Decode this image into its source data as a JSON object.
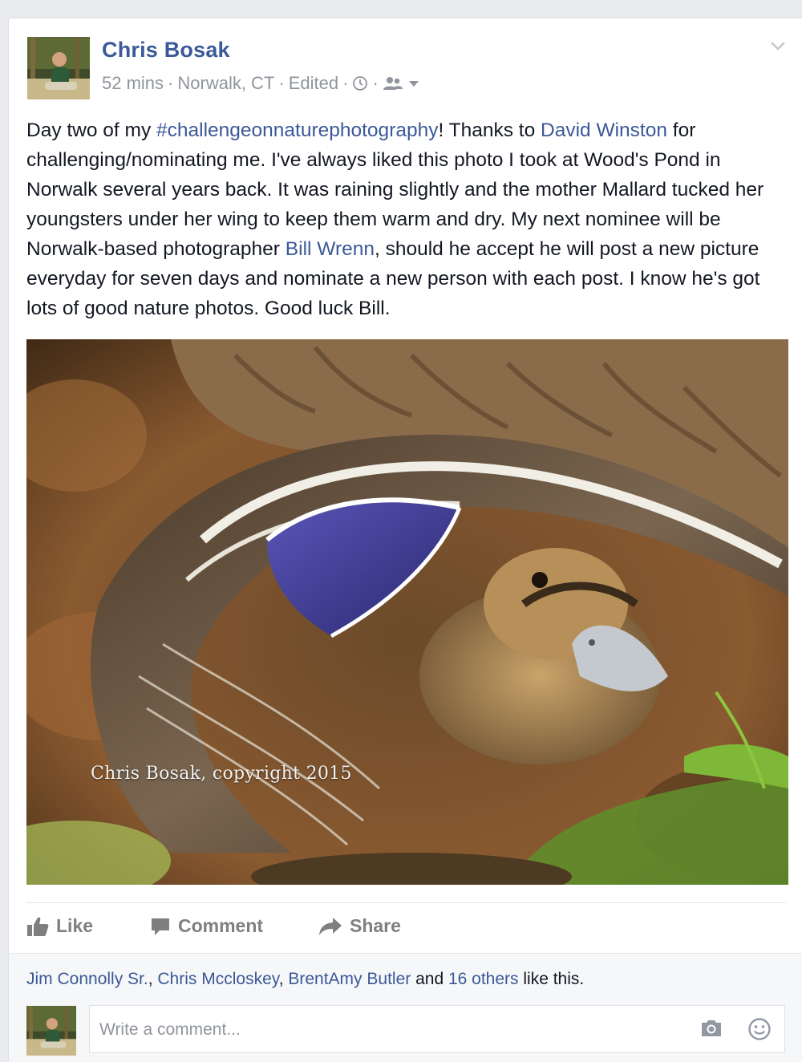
{
  "post": {
    "author": "Chris Bosak",
    "time": "52 mins",
    "location": "Norwalk, CT",
    "edited": "Edited",
    "text": {
      "p1": "Day two of my ",
      "hashtag": "#challengeonnaturephotography",
      "p2": "! Thanks to ",
      "mention1": "David Winston",
      "p3": " for challenging/nominating me. I've always liked this photo I took at Wood's Pond in Norwalk several years back. It was raining slightly and the mother Mallard tucked her youngsters under her wing to keep them warm and dry. My next nominee will be Norwalk-based photographer ",
      "mention2": "Bill Wrenn",
      "p4": ", should he accept he will post a new picture everyday for seven days and nominate a new person with each post. I know he's got lots of good nature photos. Good luck Bill."
    },
    "photo_watermark": "Chris Bosak, copyright 2015"
  },
  "actions": {
    "like": "Like",
    "comment": "Comment",
    "share": "Share"
  },
  "likes": {
    "name1": "Jim Connolly Sr.",
    "name2": "Chris Mccloskey",
    "name3": "BrentAmy Butler",
    "and": " and ",
    "others": "16 others",
    "suffix": " like this."
  },
  "comment_box": {
    "placeholder": "Write a comment..."
  },
  "colors": {
    "link": "#3b5998",
    "meta": "#90949c",
    "action": "#7f7f7f",
    "background": "#e9ebee"
  },
  "icons": [
    "chevron-down-icon",
    "clock-icon",
    "friends-icon",
    "like-icon",
    "comment-icon",
    "share-icon",
    "camera-icon",
    "smiley-icon"
  ]
}
